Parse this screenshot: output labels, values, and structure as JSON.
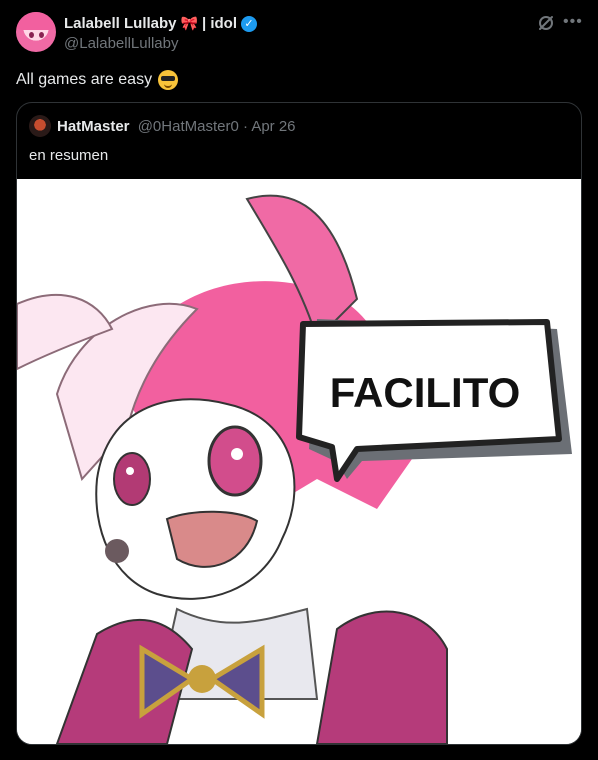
{
  "post": {
    "display_name": "Lalabell Lullaby",
    "name_emoji": "🎀",
    "name_suffix": "| idol",
    "handle": "@LalabellLullaby",
    "text": "All games are easy",
    "text_emoji": "smiling-face-with-sunglasses"
  },
  "quote": {
    "display_name": "HatMaster",
    "handle": "@0HatMaster0",
    "separator": "·",
    "date": "Apr 26",
    "text": "en resumen",
    "image_caption_text": "FACILITO"
  },
  "icons": {
    "verified": "verified-badge-icon",
    "grok": "grok-icon",
    "more": "more-icon"
  },
  "colors": {
    "accent": "#1d9bf0",
    "hair_pink": "#f2609f",
    "speech_bubble": "#ffffff"
  }
}
